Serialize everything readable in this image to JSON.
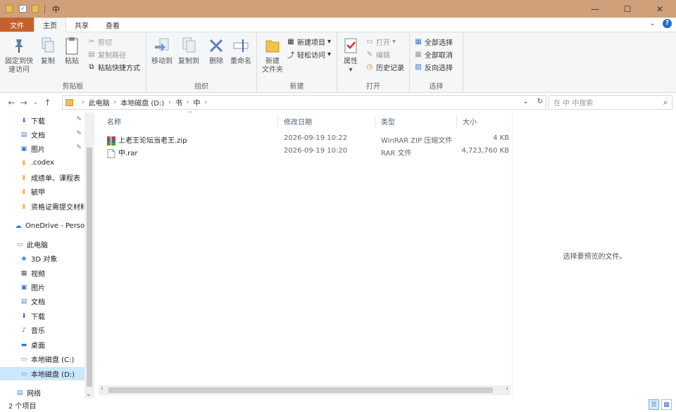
{
  "window": {
    "title": "中",
    "minimize_glyph": "—",
    "maximize_glyph": "☐",
    "close_glyph": "✕"
  },
  "ribbon_tabs": {
    "file": "文件",
    "home": "主页",
    "share": "共享",
    "view": "查看",
    "collapse_glyph": "⌄",
    "help_glyph": "?"
  },
  "clipboard": {
    "pin_quick_access": "固定到快速访问",
    "copy": "复制",
    "paste": "粘贴",
    "cut": "剪切",
    "copy_path": "复制路径",
    "paste_shortcut": "粘贴快捷方式",
    "group_label": "剪贴板"
  },
  "organize": {
    "move_to": "移动到",
    "copy_to": "复制到",
    "delete": "删除",
    "rename": "重命名",
    "group_label": "组织"
  },
  "new_group": {
    "new_folder": "新建\n文件夹",
    "new_item": "新建项目",
    "easy_access": "轻松访问",
    "group_label": "新建"
  },
  "open_group": {
    "properties": "属性",
    "open": "打开",
    "edit": "编辑",
    "history": "历史记录",
    "group_label": "打开"
  },
  "select_group": {
    "select_all": "全部选择",
    "select_none": "全部取消",
    "invert_selection": "反向选择",
    "group_label": "选择"
  },
  "address": {
    "crumbs": [
      "此电脑",
      "本地磁盘 (D:)",
      "书",
      "中"
    ],
    "search_placeholder": "在 中 中搜索"
  },
  "nav_pane": {
    "quick_access": [
      {
        "label": "下载",
        "pinned": true
      },
      {
        "label": "文档",
        "pinned": true
      },
      {
        "label": "图片",
        "pinned": true
      },
      {
        "label": ".codex",
        "pinned": false
      },
      {
        "label": "成绩单、课程表",
        "pinned": false
      },
      {
        "label": "毓甲",
        "pinned": false
      },
      {
        "label": "资格证需提交材料",
        "pinned": false
      }
    ],
    "onedrive": "OneDrive - Perso",
    "this_pc": "此电脑",
    "this_pc_items": [
      "3D 对象",
      "视频",
      "图片",
      "文档",
      "下载",
      "音乐",
      "桌面",
      "本地磁盘 (C:)",
      "本地磁盘 (D:)"
    ],
    "network": "网络"
  },
  "file_list": {
    "columns": {
      "name": "名称",
      "modified": "修改日期",
      "type": "类型",
      "size": "大小"
    },
    "rows": [
      {
        "name": "上老王论坛当老王.zip",
        "modified": "2026-09-19 10:22",
        "type": "WinRAR ZIP 压缩文件",
        "size": "4 KB"
      },
      {
        "name": "中.rar",
        "modified": "2026-09-19 10:20",
        "type": "RAR 文件",
        "size": "4,723,760 KB"
      }
    ]
  },
  "preview": {
    "empty_text": "选择要预览的文件。"
  },
  "status": {
    "item_count": "2 个项目"
  }
}
